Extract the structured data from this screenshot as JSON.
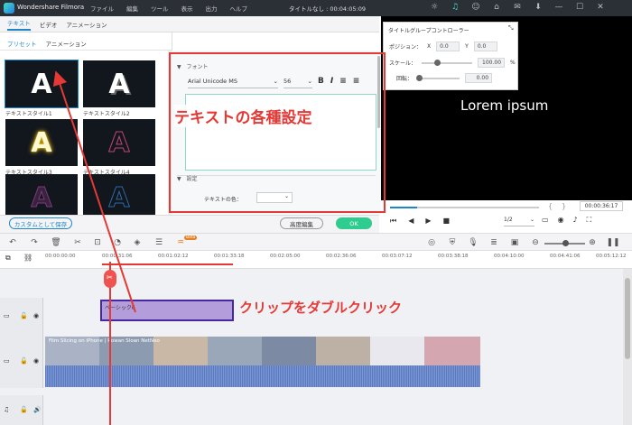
{
  "titlebar": {
    "app_name": "Wondershare Filmora",
    "menu": [
      "ファイル",
      "編集",
      "ツール",
      "表示",
      "出力",
      "ヘルプ"
    ],
    "project_title": "タイトルなし : 00:04:05:09"
  },
  "top_tabs": [
    "テキスト",
    "ビデオ",
    "アニメーション"
  ],
  "sub_tabs": [
    "プリセット",
    "アニメーション"
  ],
  "presets": [
    {
      "label": "テキストスタイル1",
      "letter": "A",
      "style": "white"
    },
    {
      "label": "テキストスタイル2",
      "letter": "A",
      "style": "white-shadow"
    },
    {
      "label": "テキストスタイル3",
      "letter": "A",
      "style": "yellow-glow"
    },
    {
      "label": "テキストスタイル4",
      "letter": "A",
      "style": "pink-outline"
    },
    {
      "label": "",
      "letter": "A",
      "style": "purple"
    },
    {
      "label": "",
      "letter": "A",
      "style": "blue-outline"
    }
  ],
  "font_section": {
    "header": "フォント",
    "font_name": "Arial Unicode MS",
    "font_size": "56",
    "bold": "B",
    "italic": "I"
  },
  "settings_section": {
    "header": "設定",
    "text_color_label": "テキストの色："
  },
  "buttons": {
    "save_custom": "カスタムとして保存",
    "advanced_edit": "高度編集",
    "ok": "OK"
  },
  "title_group_control": {
    "title": "タイトルグループコントローラー",
    "position_label": "ポジション：",
    "x_label": "X",
    "x_value": "0.0",
    "y_label": "Y",
    "y_value": "0.0",
    "scale_label": "スケール：",
    "scale_value": "100.00",
    "scale_unit": "%",
    "rotate_label": "回転：",
    "rotate_value": "0.00"
  },
  "preview": {
    "text": "Lorem ipsum",
    "timecode": "00:00:36:17",
    "quality": "1/2"
  },
  "ruler_ticks": [
    "00:00:00:00",
    "00:00:31:06",
    "00:01:02:12",
    "00:01:33:18",
    "00:02:05:00",
    "00:02:36:06",
    "00:03:07:12",
    "00:03:38:18",
    "00:04:10:00",
    "00:04:41:06",
    "00:05:12:12"
  ],
  "timeline": {
    "title_clip_label": "ベーシック6",
    "video_clip_label": "Film Slicing on iPhone | Rowan Sloan NetNeo",
    "beta_badge": "Beta"
  },
  "annotations": {
    "text_settings": "テキストの各種設定",
    "double_click": "クリップをダブルクリック"
  },
  "colors": {
    "accent": "#1d86c8",
    "ok_green": "#2ecc8f",
    "annotation_red": "#e53935",
    "title_clip": "#b39ddb",
    "title_clip_border": "#4527a0"
  }
}
